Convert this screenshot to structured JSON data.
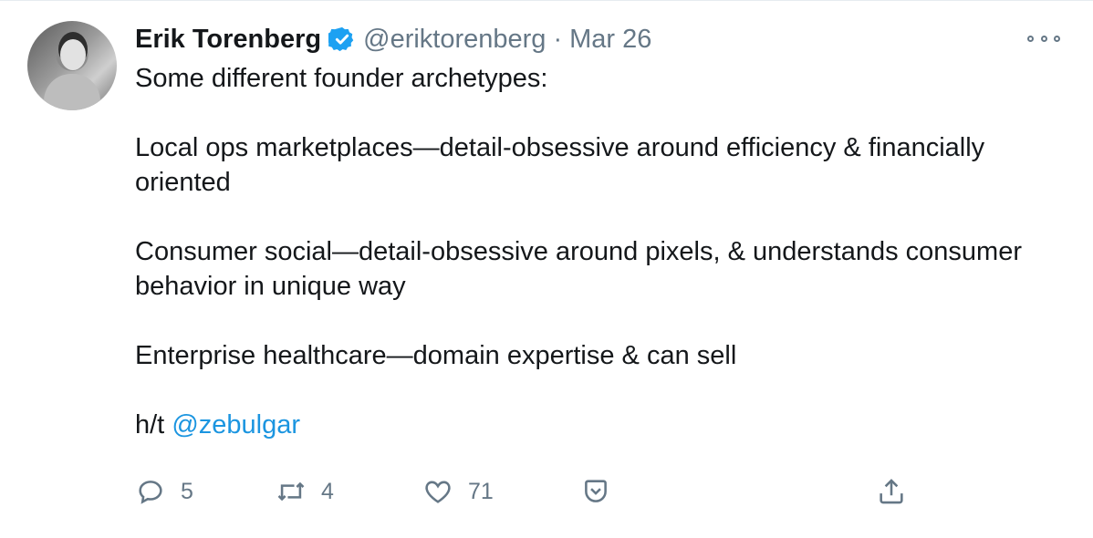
{
  "tweet": {
    "author_name": "Erik Torenberg",
    "handle": "@eriktorenberg",
    "separator": "·",
    "date": "Mar 26",
    "lines": [
      "Some different founder archetypes:",
      "",
      "Local ops marketplaces—detail-obsessive around efficiency & financially oriented",
      "",
      "Consumer social—detail-obsessive around pixels, & understands consumer behavior in unique way",
      "",
      "Enterprise healthcare—domain expertise & can sell",
      ""
    ],
    "ht_prefix": "h/t",
    "mention": "@zebulgar"
  },
  "actions": {
    "reply_count": "5",
    "retweet_count": "4",
    "like_count": "71"
  },
  "icons": [
    "verified-badge-icon",
    "more-icon",
    "reply-icon",
    "retweet-icon",
    "like-icon",
    "bookmark-icon",
    "share-icon"
  ],
  "colors": {
    "link": "#1b95e0",
    "secondary": "#657786",
    "verified": "#1da1f2"
  }
}
